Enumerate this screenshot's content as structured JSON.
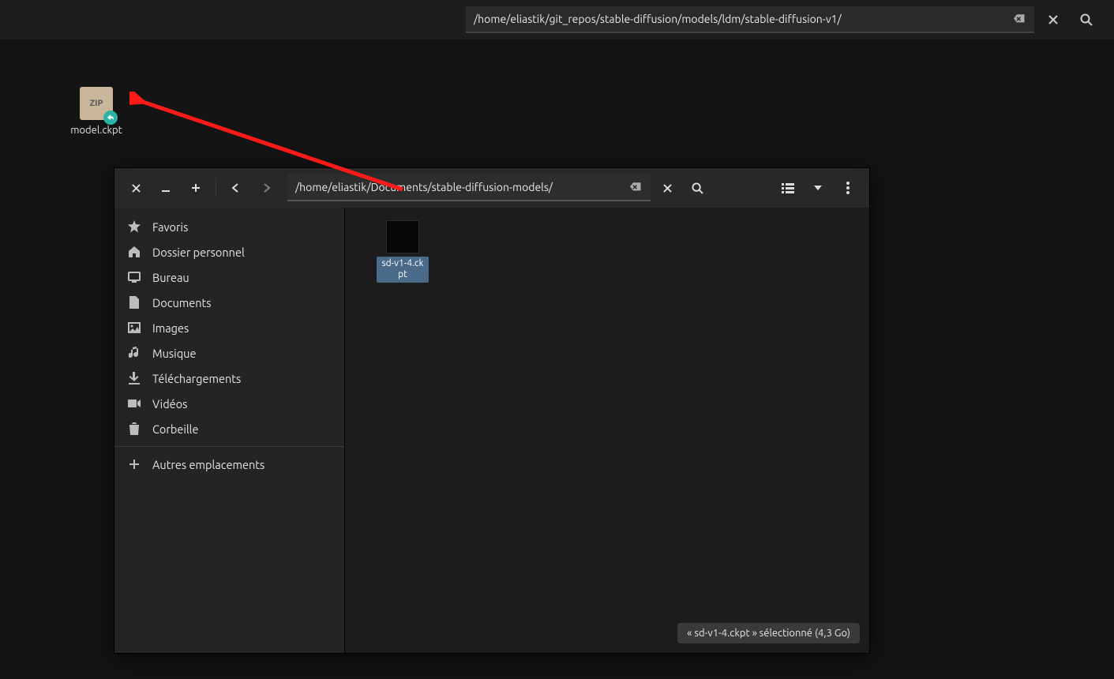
{
  "bg_window": {
    "path": "/home/eliastik/git_repos/stable-diffusion/models/ldm/stable-diffusion-v1/",
    "file": {
      "label": "model.ckpt",
      "icon_text": "ZIP"
    }
  },
  "fg_window": {
    "path": "/home/eliastik/Documents/stable-diffusion-models/",
    "file": {
      "label": "sd-v1-4.ckpt"
    },
    "sidebar": [
      {
        "icon": "star",
        "label": "Favoris"
      },
      {
        "icon": "home",
        "label": "Dossier personnel"
      },
      {
        "icon": "desktop",
        "label": "Bureau"
      },
      {
        "icon": "file",
        "label": "Documents"
      },
      {
        "icon": "image",
        "label": "Images"
      },
      {
        "icon": "music",
        "label": "Musique"
      },
      {
        "icon": "download",
        "label": "Téléchargements"
      },
      {
        "icon": "video",
        "label": "Vidéos"
      },
      {
        "icon": "trash",
        "label": "Corbeille"
      }
    ],
    "other_locations": {
      "icon": "plus",
      "label": "Autres emplacements"
    },
    "status": "« sd-v1-4.ckpt » sélectionné  (4,3 Go)"
  }
}
